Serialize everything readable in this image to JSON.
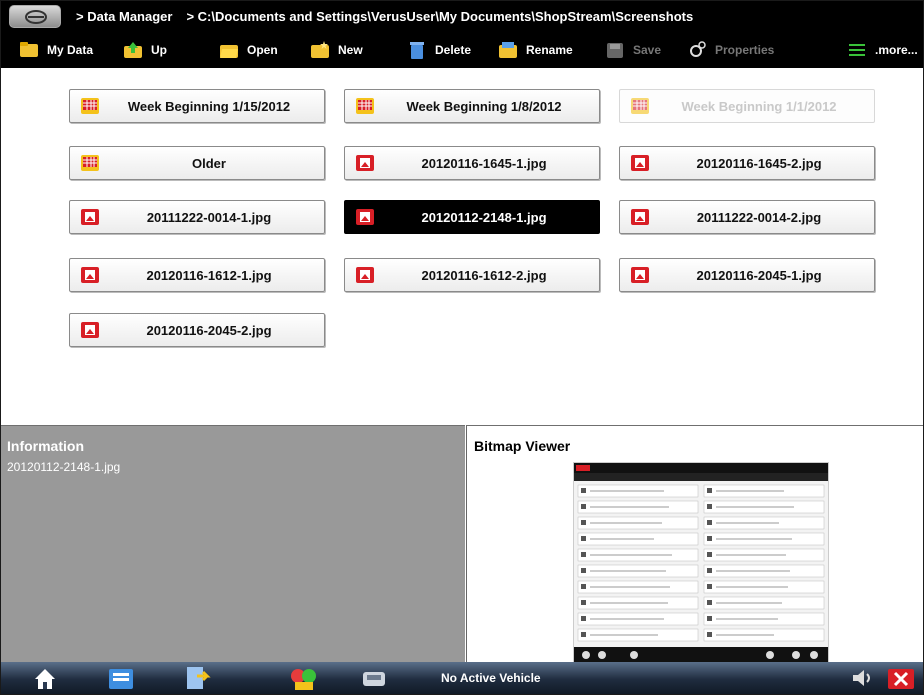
{
  "titlebar": {
    "breadcrumb_1": "> Data Manager",
    "breadcrumb_2": "> C:\\Documents and Settings\\VerusUser\\My Documents\\ShopStream\\Screenshots"
  },
  "toolbar": {
    "my_data": "My Data",
    "up": "Up",
    "open": "Open",
    "new": "New",
    "delete": "Delete",
    "rename": "Rename",
    "save": "Save",
    "properties": "Properties",
    "more": ".more..."
  },
  "files": [
    {
      "label": "Week Beginning 1/15/2012",
      "type": "calendar-folder"
    },
    {
      "label": "Week Beginning 1/8/2012",
      "type": "calendar-folder"
    },
    {
      "label": "Week Beginning 1/1/2012",
      "type": "calendar-folder",
      "state": "disabled"
    },
    {
      "label": "Older",
      "type": "calendar-folder"
    },
    {
      "label": "20120116-1645-1.jpg",
      "type": "image-file"
    },
    {
      "label": "20120116-1645-2.jpg",
      "type": "image-file"
    },
    {
      "label": "20111222-0014-1.jpg",
      "type": "image-file"
    },
    {
      "label": "20120112-2148-1.jpg",
      "type": "image-file",
      "state": "selected"
    },
    {
      "label": "20111222-0014-2.jpg",
      "type": "image-file"
    },
    {
      "label": "20120116-1612-1.jpg",
      "type": "image-file"
    },
    {
      "label": "20120116-1612-2.jpg",
      "type": "image-file"
    },
    {
      "label": "20120116-2045-1.jpg",
      "type": "image-file"
    },
    {
      "label": "20120116-2045-2.jpg",
      "type": "image-file"
    }
  ],
  "info_panel": {
    "heading": "Information",
    "value": "20120112-2148-1.jpg"
  },
  "viewer_panel": {
    "heading": "Bitmap Viewer"
  },
  "taskbar": {
    "status": "No Active Vehicle"
  },
  "colors": {
    "selected_bg": "#000000",
    "info_bg": "#999999",
    "image_icon": "#d81f26",
    "calendar_icon": "#f4c21b"
  },
  "icons": [
    "home-icon",
    "scanner-icon",
    "data-manager-icon",
    "tools-icon",
    "vehicle-icon",
    "speaker-icon",
    "exit-icon"
  ]
}
